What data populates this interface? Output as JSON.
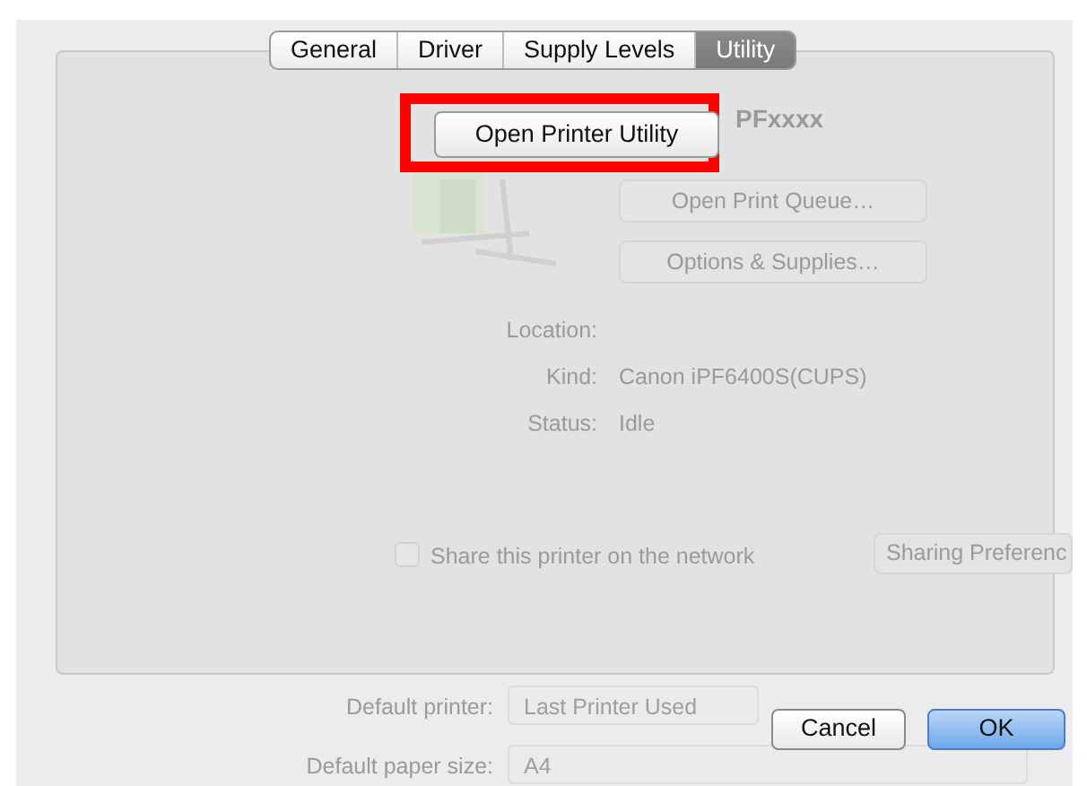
{
  "tabs": [
    {
      "label": "General",
      "selected": false
    },
    {
      "label": "Driver",
      "selected": false
    },
    {
      "label": "Supply Levels",
      "selected": false
    },
    {
      "label": "Utility",
      "selected": true
    }
  ],
  "utility_button": {
    "label": "Open Printer Utility",
    "highlighted": true
  },
  "background": {
    "printer_name": "PFxxxx",
    "buttons": [
      "Open Print Queue…",
      "Options & Supplies…"
    ],
    "info": [
      {
        "label": "Location:"
      },
      {
        "label": "Kind:",
        "value": "Canon iPF6400S(CUPS)"
      },
      {
        "label": "Status:",
        "value": "Idle"
      }
    ],
    "sharing": {
      "label": "Share this printer on the network",
      "checked": false,
      "button": "Sharing Preferenc"
    },
    "defaults": [
      {
        "label": "Default printer:",
        "value": "Last Printer Used"
      },
      {
        "label": "Default paper size:",
        "value": "A4"
      }
    ]
  },
  "buttons": [
    {
      "label": "Cancel",
      "default": false
    },
    {
      "label": "OK",
      "default": true
    }
  ]
}
